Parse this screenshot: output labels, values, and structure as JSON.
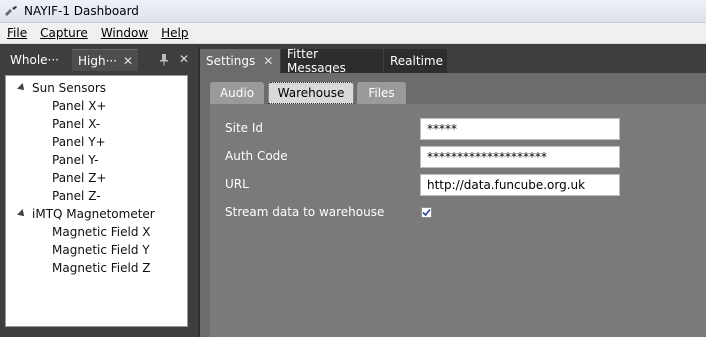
{
  "window": {
    "title": "NAYIF-1 Dashboard",
    "icon": "satellite-icon"
  },
  "menu": [
    "File",
    "Capture",
    "Window",
    "Help"
  ],
  "left_panel": {
    "tabs": [
      {
        "label": "Whole···",
        "active": true
      },
      {
        "label": "High···",
        "active": false
      }
    ],
    "tree": [
      {
        "label": "Sun Sensors",
        "children": [
          "Panel X+",
          "Panel X-",
          "Panel Y+",
          "Panel Y-",
          "Panel Z+",
          "Panel Z-"
        ]
      },
      {
        "label": "iMTQ Magnetometer",
        "children": [
          "Magnetic Field X",
          "Magnetic Field Y",
          "Magnetic Field Z"
        ]
      }
    ]
  },
  "right_panel": {
    "tabs": [
      {
        "label": "Settings",
        "active": true,
        "closable": true
      },
      {
        "label": "Fitter Messages",
        "active": false
      },
      {
        "label": "Realtime",
        "active": false
      }
    ],
    "inner_tabs": [
      {
        "label": "Audio",
        "active": false
      },
      {
        "label": "Warehouse",
        "active": true
      },
      {
        "label": "Files",
        "active": false
      }
    ],
    "form": {
      "site_id": {
        "label": "Site Id",
        "value": "*****"
      },
      "auth_code": {
        "label": "Auth Code",
        "value": "********************"
      },
      "url": {
        "label": "URL",
        "value": "http://data.funcube.org.uk"
      },
      "stream": {
        "label": "Stream data to warehouse",
        "checked": true
      }
    }
  },
  "colors": {
    "dark_bg": "#3e3e40",
    "panel_bg": "#6c6c6c",
    "form_bg": "#7a7a7a",
    "accent": "#2a4a9a"
  }
}
